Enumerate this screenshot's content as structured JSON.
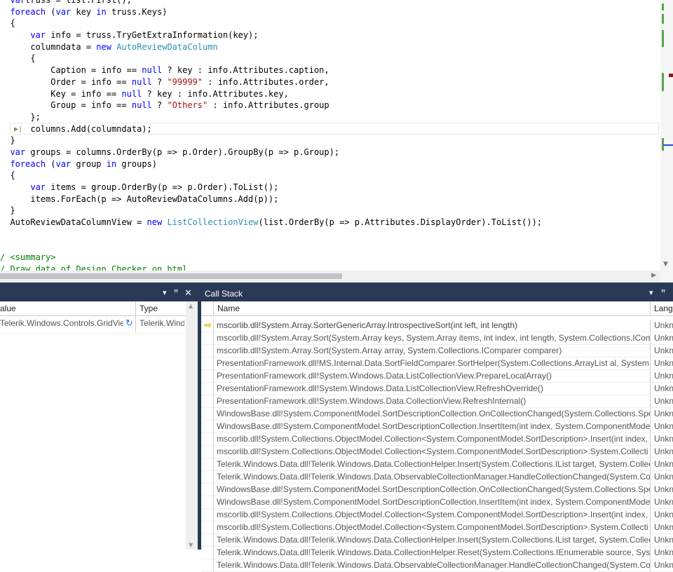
{
  "editor": {
    "lines": [
      [
        [
          "kw",
          "var"
        ],
        [
          "",
          "truss = list.First();"
        ]
      ],
      [
        [
          "kw",
          "foreach"
        ],
        [
          "",
          " ("
        ],
        [
          "kw",
          "var"
        ],
        [
          "",
          " key "
        ],
        [
          "kw",
          "in"
        ],
        [
          "",
          " truss.Keys)"
        ]
      ],
      [
        [
          "",
          "{"
        ]
      ],
      [
        [
          "",
          "    "
        ],
        [
          "kw",
          "var"
        ],
        [
          "",
          " info = truss.TryGetExtraInformation(key);"
        ]
      ],
      [
        [
          "",
          "    columndata = "
        ],
        [
          "kw",
          "new"
        ],
        [
          "",
          " "
        ],
        [
          "ty",
          "AutoReviewDataColumn"
        ]
      ],
      [
        [
          "",
          "    {"
        ]
      ],
      [
        [
          "",
          "        Caption = info == "
        ],
        [
          "kw",
          "null"
        ],
        [
          "",
          " ? key : info.Attributes.caption,"
        ]
      ],
      [
        [
          "",
          "        Order = info == "
        ],
        [
          "kw",
          "null"
        ],
        [
          "",
          " ? "
        ],
        [
          "str",
          "\"99999\""
        ],
        [
          "",
          " : info.Attributes.order,"
        ]
      ],
      [
        [
          "",
          "        Key = info == "
        ],
        [
          "kw",
          "null"
        ],
        [
          "",
          " ? key : info.Attributes.key,"
        ]
      ],
      [
        [
          "",
          "        Group = info == "
        ],
        [
          "kw",
          "null"
        ],
        [
          "",
          " ? "
        ],
        [
          "str",
          "\"Others\""
        ],
        [
          "",
          " : info.Attributes.group"
        ]
      ],
      [
        [
          "",
          "    };"
        ]
      ],
      [
        [
          "",
          "    columns.Add(columndata);"
        ]
      ],
      [
        [
          "",
          "}"
        ]
      ],
      [
        [
          "kw",
          "var"
        ],
        [
          "",
          " groups = columns.OrderBy(p => p.Order).GroupBy(p => p.Group);"
        ]
      ],
      [
        [
          "kw",
          "foreach"
        ],
        [
          "",
          " ("
        ],
        [
          "kw",
          "var"
        ],
        [
          "",
          " group "
        ],
        [
          "kw",
          "in"
        ],
        [
          "",
          " groups)"
        ]
      ],
      [
        [
          "",
          "{"
        ]
      ],
      [
        [
          "",
          "    "
        ],
        [
          "kw",
          "var"
        ],
        [
          "",
          " items = group.OrderBy(p => p.Order).ToList();"
        ]
      ],
      [
        [
          "",
          "    items.ForEach(p => AutoReviewDataColumns.Add(p));"
        ]
      ],
      [
        [
          "",
          "}"
        ]
      ],
      [
        [
          "",
          "AutoReviewDataColumnView = "
        ],
        [
          "kw",
          "new"
        ],
        [
          "",
          " "
        ],
        [
          "ty",
          "ListCollectionView"
        ],
        [
          "",
          "(list.OrderBy(p => p.Attributes.DisplayOrder).ToList());"
        ]
      ],
      [
        [
          "",
          ""
        ]
      ],
      [
        [
          "",
          ""
        ]
      ],
      [
        [
          "cm",
          "/ <summary>"
        ]
      ],
      [
        [
          "cm",
          "/ Draw data of Design Checker on html"
        ]
      ]
    ],
    "line_starts": [
      "var truss = list.First();",
      "foreach (var key in truss.Keys)"
    ]
  },
  "autos": {
    "col_value": "alue",
    "col_type": "Type",
    "rows": [
      {
        "value": "Telerik.Windows.Controls.GridView",
        "type": "Telerik.Wind"
      }
    ]
  },
  "callstack": {
    "title": "Call Stack",
    "col_name": "Name",
    "col_lang": "Lang",
    "rows": [
      {
        "name": "mscorlib.dll!System.Array.SorterGenericArray.IntrospectiveSort(int left, int length)",
        "lang": "Unkn",
        "current": true
      },
      {
        "name": "mscorlib.dll!System.Array.Sort(System.Array keys, System.Array items, int index, int length, System.Collections.ICompa",
        "lang": "Unkn"
      },
      {
        "name": "mscorlib.dll!System.Array.Sort(System.Array array, System.Collections.IComparer comparer)",
        "lang": "Unkn"
      },
      {
        "name": "PresentationFramework.dll!MS.Internal.Data.SortFieldComparer.SortHelper(System.Collections.ArrayList al, System.Co",
        "lang": "Unkn"
      },
      {
        "name": "PresentationFramework.dll!System.Windows.Data.ListCollectionView.PrepareLocalArray()",
        "lang": "Unkn"
      },
      {
        "name": "PresentationFramework.dll!System.Windows.Data.ListCollectionView.RefreshOverride()",
        "lang": "Unkn"
      },
      {
        "name": "PresentationFramework.dll!System.Windows.Data.CollectionView.RefreshInternal()",
        "lang": "Unkn"
      },
      {
        "name": "WindowsBase.dll!System.ComponentModel.SortDescriptionCollection.OnCollectionChanged(System.Collections.Spec",
        "lang": "Unkn"
      },
      {
        "name": "WindowsBase.dll!System.ComponentModel.SortDescriptionCollection.InsertItem(int index, System.ComponentModel",
        "lang": "Unkn"
      },
      {
        "name": "mscorlib.dll!System.Collections.ObjectModel.Collection<System.ComponentModel.SortDescription>.Insert(int index,",
        "lang": "Unkn"
      },
      {
        "name": "mscorlib.dll!System.Collections.ObjectModel.Collection<System.ComponentModel.SortDescription>.System.Collecti",
        "lang": "Unkn"
      },
      {
        "name": "Telerik.Windows.Data.dll!Telerik.Windows.Data.CollectionHelper.Insert(System.Collections.IList target, System.Collecti",
        "lang": "Unkn"
      },
      {
        "name": "Telerik.Windows.Data.dll!Telerik.Windows.Data.ObservableCollectionManager.HandleCollectionChanged(System.Coll",
        "lang": "Unkn"
      },
      {
        "name": "WindowsBase.dll!System.ComponentModel.SortDescriptionCollection.OnCollectionChanged(System.Collections.Spec",
        "lang": "Unkn"
      },
      {
        "name": "WindowsBase.dll!System.ComponentModel.SortDescriptionCollection.InsertItem(int index, System.ComponentModel",
        "lang": "Unkn"
      },
      {
        "name": "mscorlib.dll!System.Collections.ObjectModel.Collection<System.ComponentModel.SortDescription>.Insert(int index,",
        "lang": "Unkn"
      },
      {
        "name": "mscorlib.dll!System.Collections.ObjectModel.Collection<System.ComponentModel.SortDescription>.System.Collecti",
        "lang": "Unkn"
      },
      {
        "name": "Telerik.Windows.Data.dll!Telerik.Windows.Data.CollectionHelper.Insert(System.Collections.IList target, System.Collecti",
        "lang": "Unkn"
      },
      {
        "name": "Telerik.Windows.Data.dll!Telerik.Windows.Data.CollectionHelper.Reset(System.Collections.IEnumerable source, System",
        "lang": "Unkn"
      },
      {
        "name": "Telerik.Windows.Data.dll!Telerik.Windows.Data.ObservableCollectionManager.HandleCollectionChanged(System.Coll",
        "lang": "Unkn"
      }
    ]
  },
  "icons": {
    "current_frame": "arrow-right-icon",
    "refresh": "refresh-icon",
    "pin": "pin-icon",
    "close": "close-icon",
    "dropdown": "dropdown-icon"
  },
  "colors": {
    "titlebar": "#293955",
    "keyword": "#0000ff",
    "type": "#2b91af",
    "string": "#a31515",
    "comment": "#008000",
    "current_arrow": "#f5d547"
  }
}
